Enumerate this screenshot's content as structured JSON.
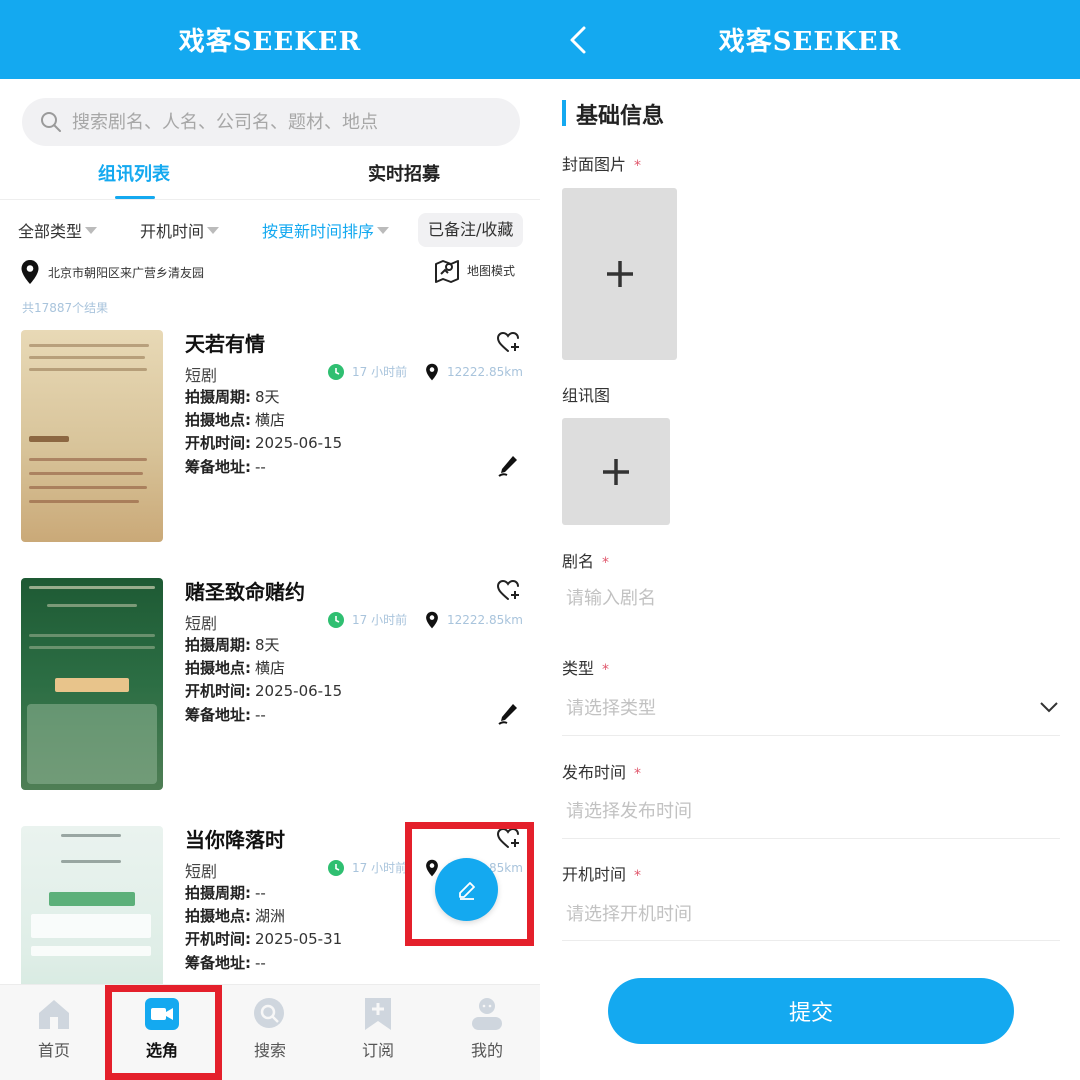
{
  "app": {
    "title": "戏客SEEKER"
  },
  "left": {
    "search_placeholder": "搜索剧名、人名、公司名、题材、地点",
    "tabs": [
      {
        "label": "组讯列表",
        "active": true
      },
      {
        "label": "实时招募",
        "active": false
      }
    ],
    "filters": {
      "type": "全部类型",
      "start_time": "开机时间",
      "sort": "按更新时间排序",
      "favorites": "已备注/收藏"
    },
    "location": "北京市朝阳区来广营乡清友园",
    "map_mode": "地图模式",
    "result_count": "共17887个结果",
    "field_labels": {
      "period": "拍摄周期:",
      "place": "拍摄地点:",
      "start": "开机时间:",
      "prep": "筹备地址:"
    },
    "cards": [
      {
        "title": "天若有情",
        "genre": "短剧",
        "time_ago": "17 小时前",
        "distance": "12222.85km",
        "period": "8天",
        "place": "横店",
        "start": "2025-06-15",
        "prep": "--"
      },
      {
        "title": "赌圣致命赌约",
        "genre": "短剧",
        "time_ago": "17 小时前",
        "distance": "12222.85km",
        "period": "8天",
        "place": "横店",
        "start": "2025-06-15",
        "prep": "--"
      },
      {
        "title": "当你降落时",
        "genre": "短剧",
        "time_ago": "17 小时前",
        "distance": "12222.85km",
        "period": "--",
        "place": "湖洲",
        "start": "2025-05-31",
        "prep": "--"
      }
    ],
    "nav": [
      {
        "label": "首页",
        "icon": "home-icon"
      },
      {
        "label": "选角",
        "icon": "video-camera-icon",
        "active": true
      },
      {
        "label": "搜索",
        "icon": "search-bubble-icon"
      },
      {
        "label": "订阅",
        "icon": "bookmark-plus-icon"
      },
      {
        "label": "我的",
        "icon": "person-icon"
      }
    ]
  },
  "right": {
    "section_title": "基础信息",
    "cover_label": "封面图片",
    "group_image_label": "组讯图",
    "name_label": "剧名",
    "name_placeholder": "请输入剧名",
    "type_label": "类型",
    "type_placeholder": "请选择类型",
    "publish_label": "发布时间",
    "publish_placeholder": "请选择发布时间",
    "start_label": "开机时间",
    "start_placeholder": "请选择开机时间",
    "required_mark": "*",
    "submit_label": "提交"
  },
  "colors": {
    "accent": "#14a9f0",
    "highlight_box": "#e4202b",
    "required": "#e0566b"
  }
}
